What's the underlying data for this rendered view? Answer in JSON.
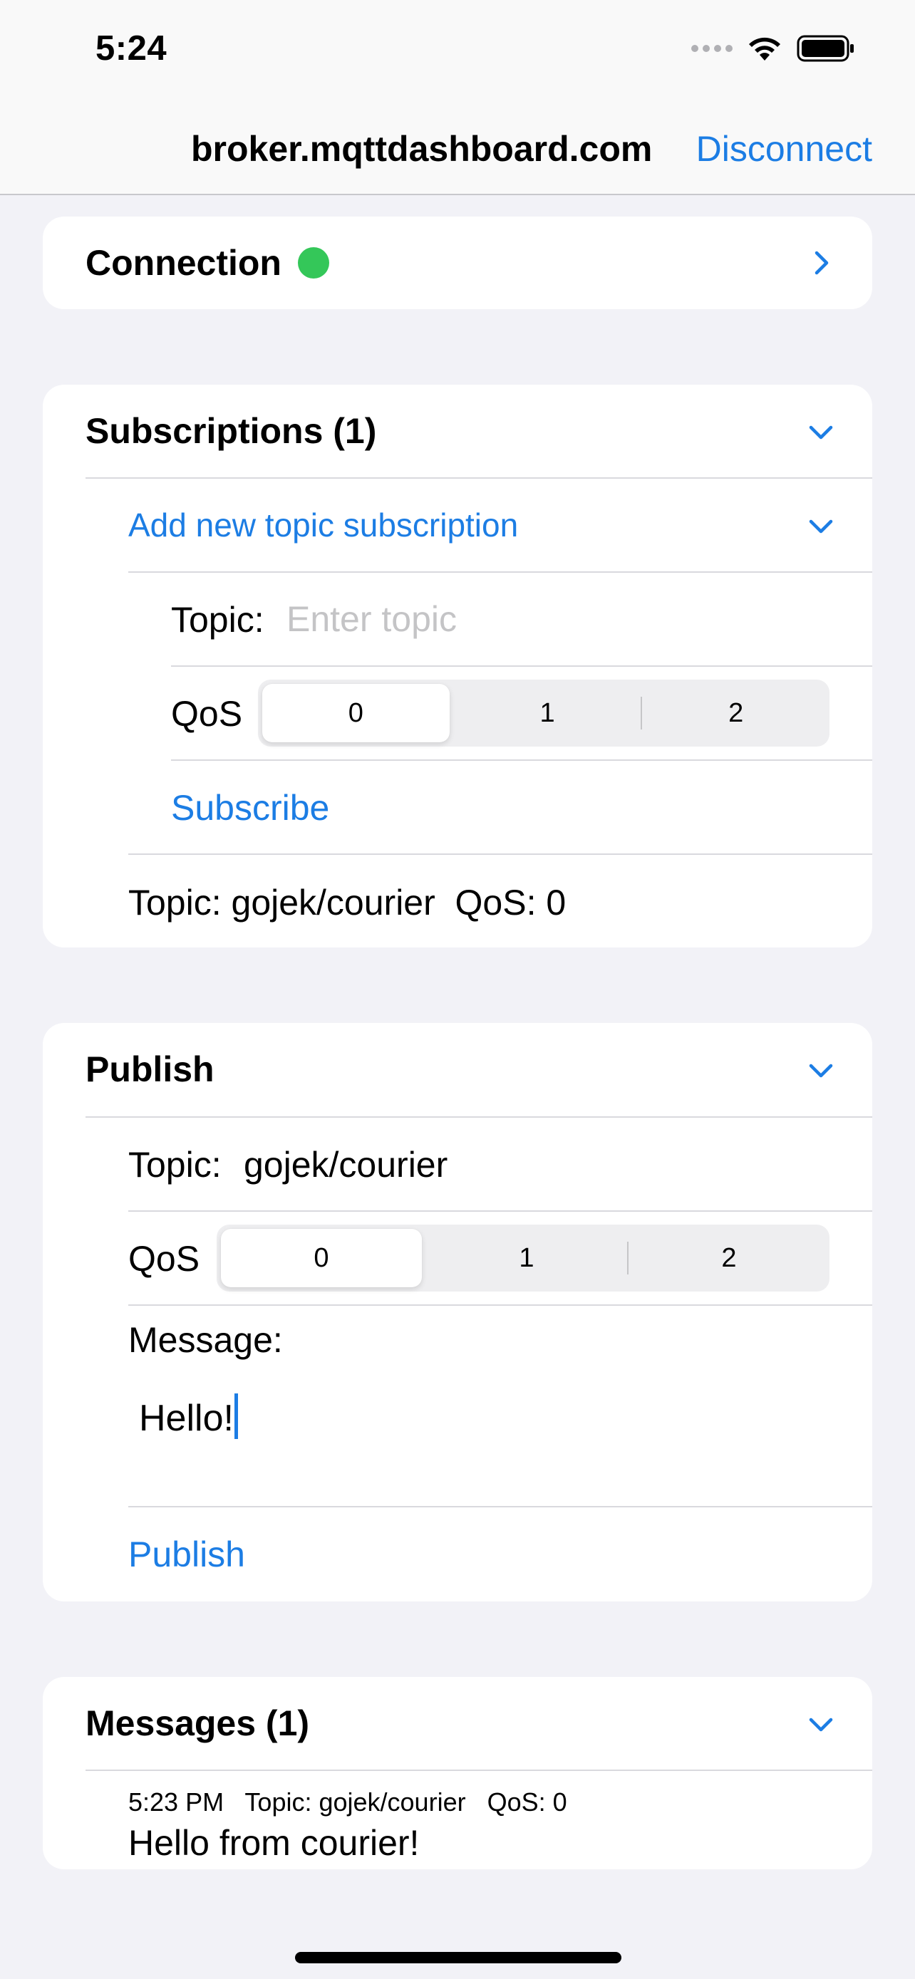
{
  "status_bar": {
    "time": "5:24"
  },
  "nav": {
    "title": "broker.mqttdashboard.com",
    "disconnect_label": "Disconnect"
  },
  "connection": {
    "label": "Connection",
    "status_color": "#34c759"
  },
  "subscriptions": {
    "header": "Subscriptions (1)",
    "add_label": "Add new topic subscription",
    "topic_label": "Topic:",
    "topic_placeholder": "Enter topic",
    "qos_label": "QoS",
    "qos_options": [
      "0",
      "1",
      "2"
    ],
    "qos_selected": "0",
    "subscribe_label": "Subscribe",
    "items": [
      {
        "text": "Topic: gojek/courier  QoS: 0"
      }
    ]
  },
  "publish": {
    "header": "Publish",
    "topic_label": "Topic:",
    "topic_value": "gojek/courier",
    "qos_label": "QoS",
    "qos_options": [
      "0",
      "1",
      "2"
    ],
    "qos_selected": "0",
    "message_label": "Message:",
    "message_value": "Hello!",
    "publish_label": "Publish"
  },
  "messages": {
    "header": "Messages (1)",
    "items": [
      {
        "meta": "5:23 PM   Topic: gojek/courier   QoS: 0",
        "body": "Hello from courier!"
      }
    ]
  },
  "colors": {
    "accent": "#1c7de4",
    "background": "#f2f2f7",
    "card": "#ffffff",
    "status_green": "#34c759"
  }
}
